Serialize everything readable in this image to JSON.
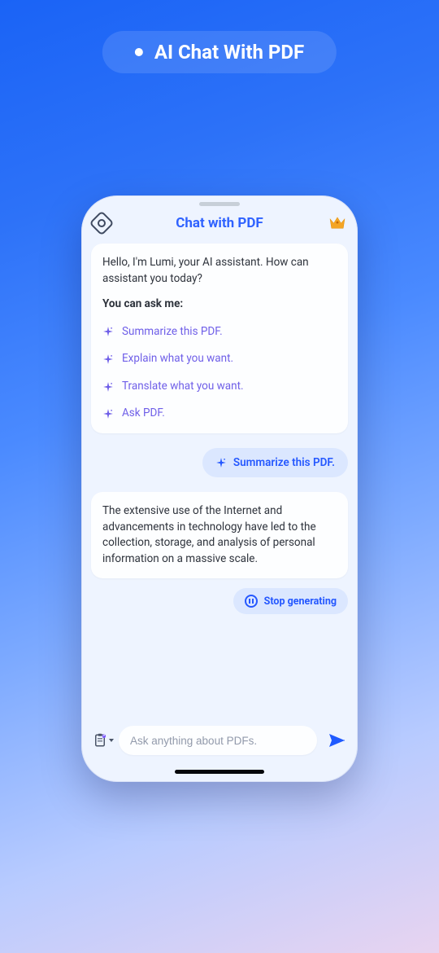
{
  "topPill": {
    "label": "AI Chat With PDF"
  },
  "header": {
    "title": "Chat with PDF"
  },
  "welcome": {
    "greeting": "Hello, I'm Lumi, your AI assistant. How can assistant you today?",
    "prompt_heading": "You can ask me:",
    "suggestions": [
      "Summarize this PDF.",
      "Explain what you want.",
      "Translate what you want.",
      "Ask PDF."
    ]
  },
  "userMessage": {
    "text": "Summarize this PDF."
  },
  "assistantResponse": {
    "text": "The extensive use of the Internet and advancements in technology have led to the collection, storage, and analysis of personal information on a massive scale."
  },
  "stop": {
    "label": "Stop generating"
  },
  "input": {
    "placeholder": "Ask anything about PDFs."
  },
  "colors": {
    "accent": "#2558ff",
    "suggestion": "#6f5fe8"
  }
}
